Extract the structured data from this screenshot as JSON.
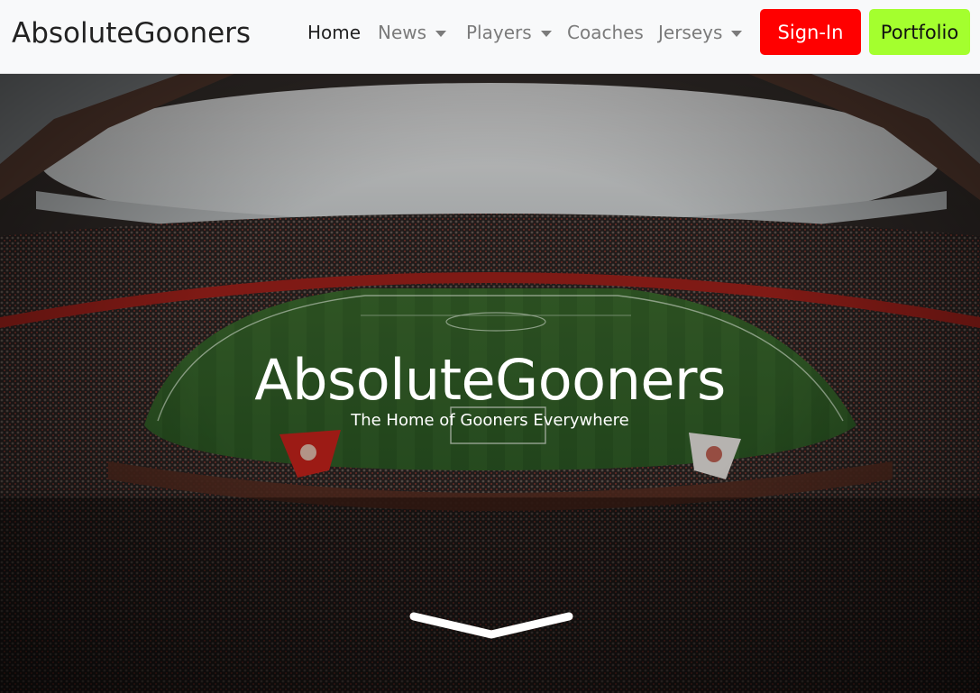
{
  "brand": "AbsoluteGooners",
  "nav": {
    "home": "Home",
    "news": "News",
    "players": "Players",
    "coaches": "Coaches",
    "jerseys": "Jerseys"
  },
  "buttons": {
    "signin": "Sign-In",
    "portfolio": "Portfolio"
  },
  "hero": {
    "title": "AbsoluteGooners",
    "subtitle": "The Home of Gooners Everywhere",
    "background_image": "stadium-photo",
    "scroll_icon": "chevron-down-icon"
  },
  "colors": {
    "signin_bg": "#ff0000",
    "portfolio_bg": "#a4ff2e",
    "navbar_bg": "#f8f9fa"
  }
}
